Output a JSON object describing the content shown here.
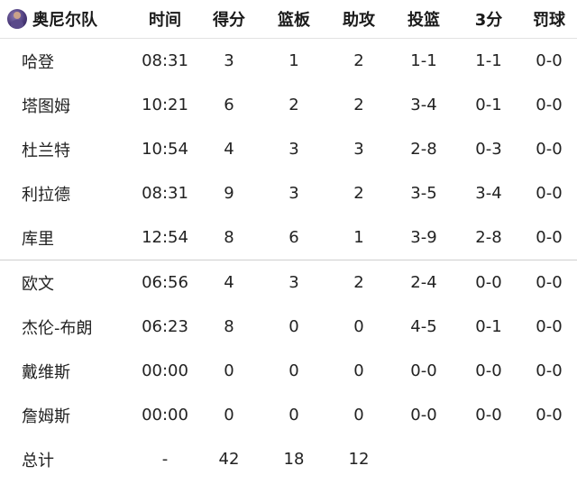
{
  "header": {
    "team": "奥尼尔队",
    "columns": [
      "时间",
      "得分",
      "篮板",
      "助攻",
      "投篮",
      "3分",
      "罚球"
    ]
  },
  "rows": [
    {
      "name": "哈登",
      "time": "08:31",
      "pts": "3",
      "reb": "1",
      "ast": "2",
      "fg": "1-1",
      "tp": "1-1",
      "ft": "0-0"
    },
    {
      "name": "塔图姆",
      "time": "10:21",
      "pts": "6",
      "reb": "2",
      "ast": "2",
      "fg": "3-4",
      "tp": "0-1",
      "ft": "0-0"
    },
    {
      "name": "杜兰特",
      "time": "10:54",
      "pts": "4",
      "reb": "3",
      "ast": "3",
      "fg": "2-8",
      "tp": "0-3",
      "ft": "0-0"
    },
    {
      "name": "利拉德",
      "time": "08:31",
      "pts": "9",
      "reb": "3",
      "ast": "2",
      "fg": "3-5",
      "tp": "3-4",
      "ft": "0-0"
    },
    {
      "name": "库里",
      "time": "12:54",
      "pts": "8",
      "reb": "6",
      "ast": "1",
      "fg": "3-9",
      "tp": "2-8",
      "ft": "0-0"
    },
    {
      "name": "欧文",
      "time": "06:56",
      "pts": "4",
      "reb": "3",
      "ast": "2",
      "fg": "2-4",
      "tp": "0-0",
      "ft": "0-0"
    },
    {
      "name": "杰伦-布朗",
      "time": "06:23",
      "pts": "8",
      "reb": "0",
      "ast": "0",
      "fg": "4-5",
      "tp": "0-1",
      "ft": "0-0"
    },
    {
      "name": "戴维斯",
      "time": "00:00",
      "pts": "0",
      "reb": "0",
      "ast": "0",
      "fg": "0-0",
      "tp": "0-0",
      "ft": "0-0"
    },
    {
      "name": "詹姆斯",
      "time": "00:00",
      "pts": "0",
      "reb": "0",
      "ast": "0",
      "fg": "0-0",
      "tp": "0-0",
      "ft": "0-0"
    }
  ],
  "total": {
    "label": "总计",
    "time": "-",
    "pts": "42",
    "reb": "18",
    "ast": "12",
    "fg": "",
    "tp": "",
    "ft": ""
  }
}
